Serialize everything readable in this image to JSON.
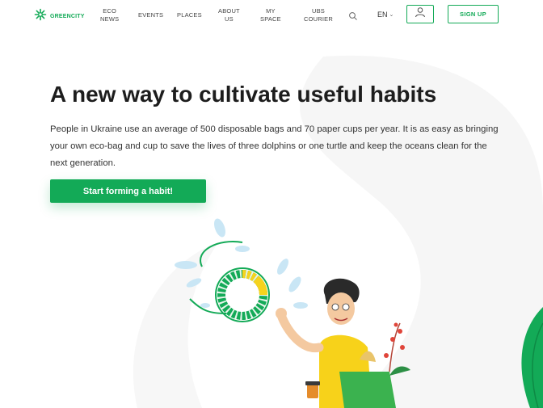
{
  "header": {
    "logo_text": "GREENCITY",
    "nav": [
      {
        "line1": "ECO",
        "line2": "NEWS"
      },
      {
        "line1": "EVENTS",
        "line2": ""
      },
      {
        "line1": "PLACES",
        "line2": ""
      },
      {
        "line1": "ABOUT",
        "line2": "US"
      },
      {
        "line1": "MY",
        "line2": "SPACE"
      },
      {
        "line1": "UBS",
        "line2": "COURIER"
      }
    ],
    "language": "EN",
    "signup_label": "SIGN UP"
  },
  "hero": {
    "title": "A new way to cultivate useful habits",
    "description": "People in Ukraine use an average of 500 disposable bags and 70 paper cups per year. It is as easy as bringing your own eco-bag and cup to save the lives of three dolphins or one turtle and keep the oceans clean for the next generation.",
    "cta_label": "Start forming a habit!"
  },
  "icons": {
    "logo": "greencity-logo-icon",
    "search": "search-icon",
    "language_chevron": "chevron-down-icon",
    "user": "user-icon"
  },
  "colors": {
    "brand_green": "#13aa57",
    "text_dark": "#1d1d1d",
    "progress_yellow": "#f5d31e",
    "light_blue": "#c9e6f5"
  }
}
